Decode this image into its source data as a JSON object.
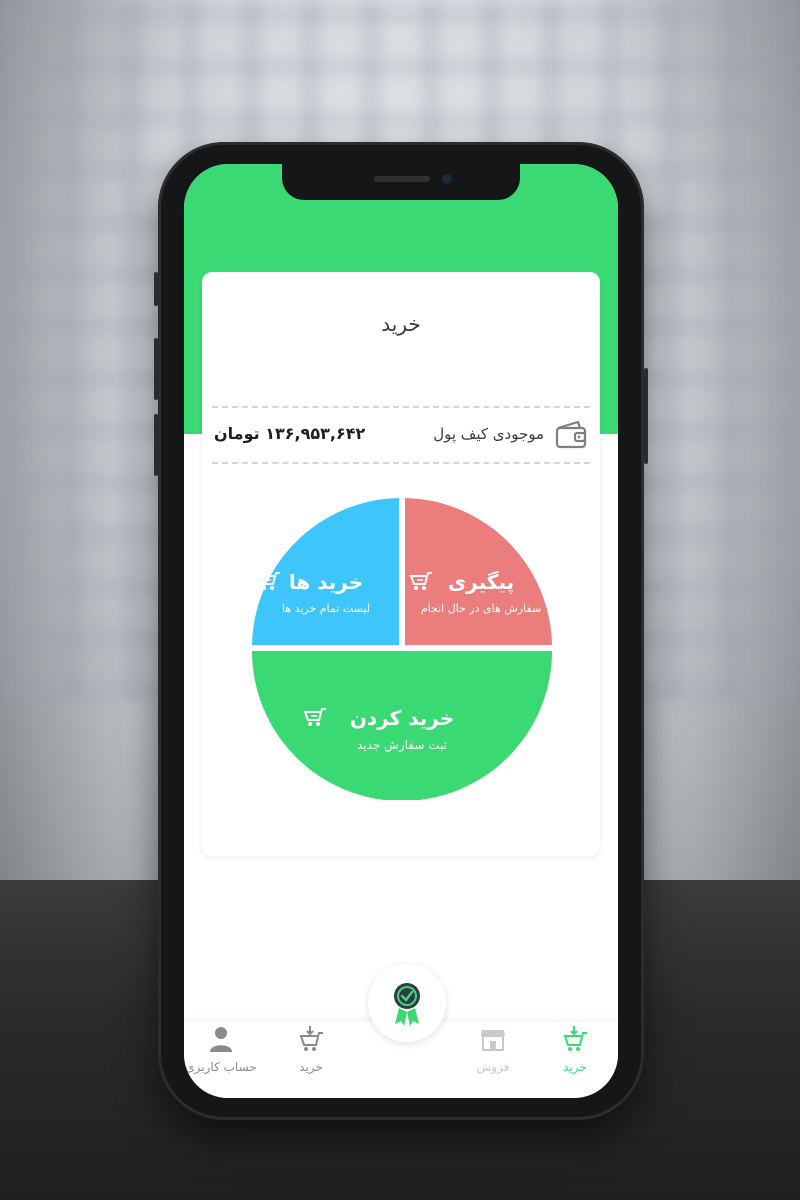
{
  "card": {
    "title": "خرید"
  },
  "wallet": {
    "label": "موجودی کیف پول",
    "balance": "۱۳۶,۹۵۳,۶۴۲ تومان"
  },
  "segments": {
    "follow_up": {
      "title": "پیگیری",
      "subtitle": "سفارش های در حال انجام",
      "color": "#ec7d7d"
    },
    "purchases": {
      "title": "خرید ها",
      "subtitle": "لیست تمام خرید ها",
      "color": "#3ec5fb"
    },
    "buy": {
      "title": "خرید کردن",
      "subtitle": "ثبت سفارش جدید",
      "color": "#3bd974"
    }
  },
  "nav": {
    "items": [
      {
        "label": "خرید",
        "icon": "cart-download-icon",
        "active": true
      },
      {
        "label": "فروش",
        "icon": "store-icon",
        "active": false
      },
      {
        "label": "خرید",
        "icon": "cart-download-icon",
        "active": false
      },
      {
        "label": "حساب کاربری",
        "icon": "user-icon",
        "active": false
      }
    ],
    "center_icon": "verified-badge-icon"
  },
  "colors": {
    "brand_green": "#3bd974",
    "inactive_nav": "#8a8a8a"
  }
}
